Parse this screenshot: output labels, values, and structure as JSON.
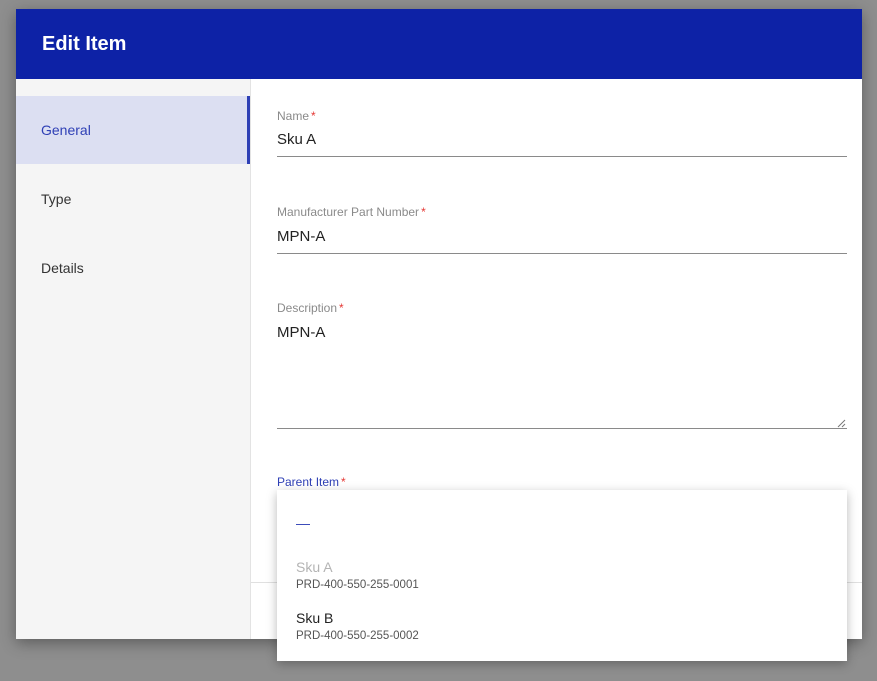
{
  "dialog": {
    "title": "Edit Item"
  },
  "sidebar": {
    "items": [
      {
        "label": "General",
        "active": true
      },
      {
        "label": "Type",
        "active": false
      },
      {
        "label": "Details",
        "active": false
      }
    ]
  },
  "form": {
    "name": {
      "label": "Name",
      "required_mark": "*",
      "value": "Sku A"
    },
    "mpn": {
      "label": "Manufacturer Part Number",
      "required_mark": "*",
      "value": "MPN-A"
    },
    "description": {
      "label": "Description",
      "required_mark": "*",
      "value": "MPN-A"
    },
    "parent_item": {
      "label": "Parent Item",
      "required_mark": "*"
    }
  },
  "dropdown": {
    "empty_option": "—",
    "options": [
      {
        "name": "Sku A",
        "code": "PRD-400-550-255-0001",
        "disabled": true
      },
      {
        "name": "Sku B",
        "code": "PRD-400-550-255-0002",
        "disabled": false
      }
    ]
  },
  "colors": {
    "header": "#0d22a6",
    "accent": "#2e3fb5",
    "active_nav_bg": "#dcdff2",
    "required": "#e53935"
  }
}
